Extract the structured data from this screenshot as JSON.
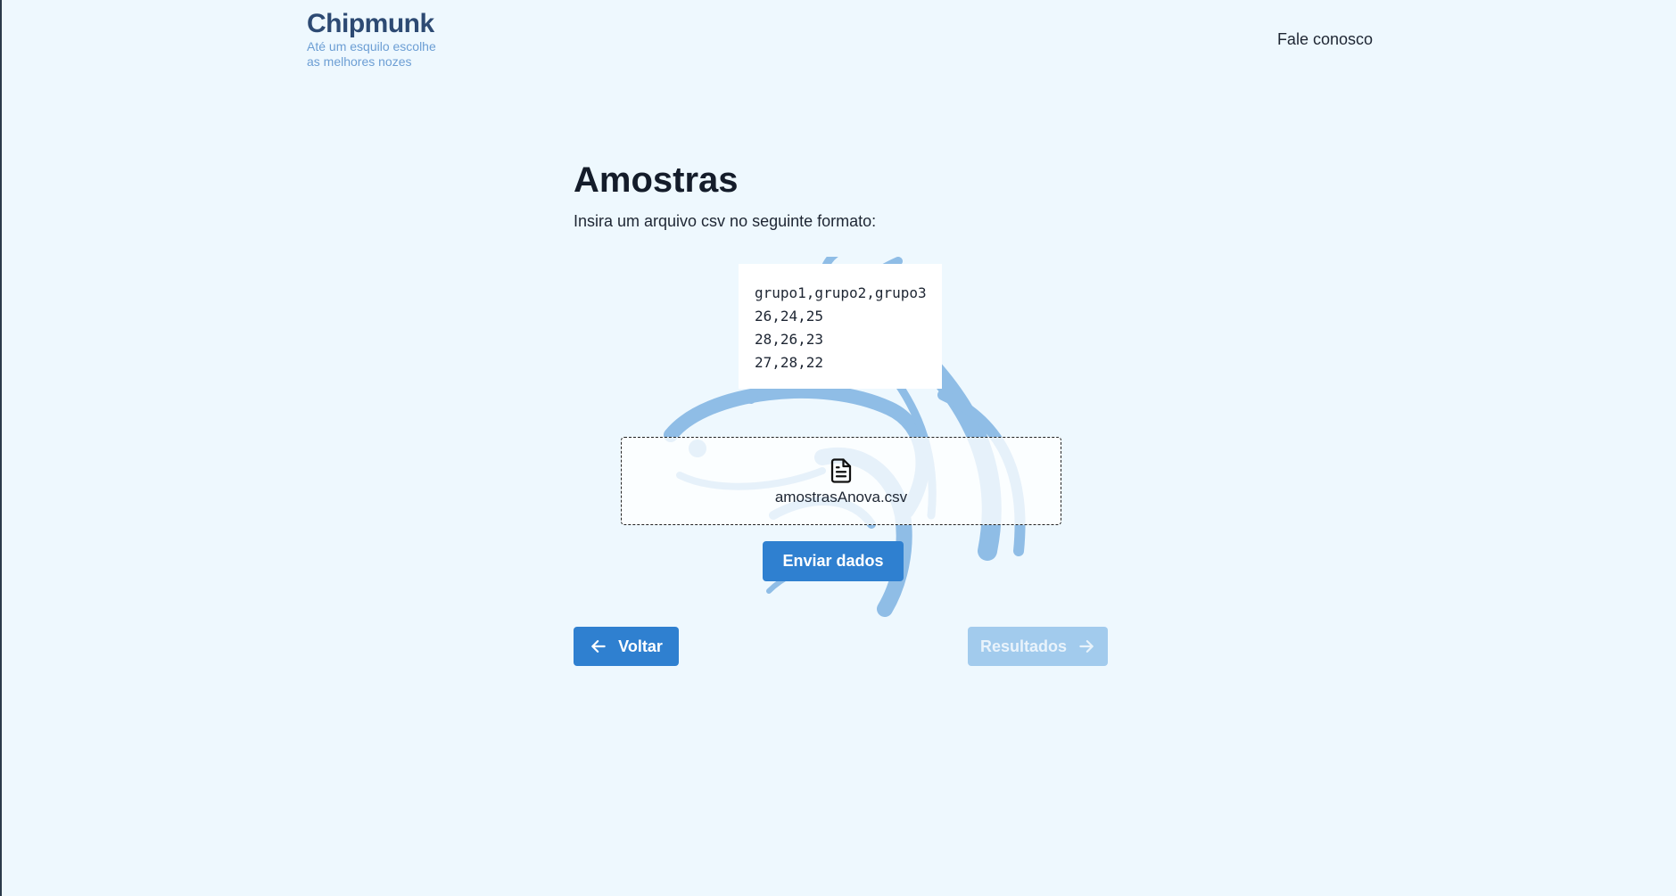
{
  "header": {
    "logo_name": "Chipmunk",
    "logo_tagline_line1": "Até um esquilo escolhe",
    "logo_tagline_line2": "as melhores nozes",
    "contact_link": "Fale conosco"
  },
  "main": {
    "title": "Amostras",
    "subtitle": "Insira um arquivo csv no seguinte formato:",
    "csv_example": [
      "grupo1,grupo2,grupo3",
      "26,24,25",
      "28,26,23",
      "27,28,22"
    ]
  },
  "upload": {
    "icon": "file-text-icon",
    "file_name": "amostrasAnova.csv"
  },
  "buttons": {
    "send_label": "Enviar dados",
    "back_label": "Voltar",
    "results_label": "Resultados",
    "results_enabled": false
  },
  "colors": {
    "background": "#eef8fe",
    "primary": "#2f80d0",
    "primary_disabled": "#a2cbed",
    "logo": "#2d4a73",
    "tagline": "#6c9ed4",
    "watermark": "#8fbde6"
  }
}
